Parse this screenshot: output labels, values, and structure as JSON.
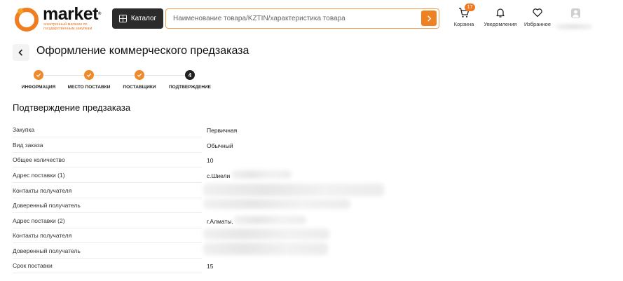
{
  "header": {
    "logo_word": "market",
    "logo_sub": "электронный магазин по государственным закупкам",
    "catalog_label": "Каталог",
    "search_placeholder": "Наименование товара/KZTIN/характеристика товара",
    "cart_label": "Корзина",
    "cart_count": "17",
    "notifications_label": "Уведомления",
    "favorites_label": "Избранное",
    "accent_color": "#ee8223"
  },
  "page": {
    "title": "Оформление коммерческого предзаказа",
    "section_title": "Подтверждение предзаказа"
  },
  "stepper": {
    "steps": [
      {
        "label": "ИНФОРМАЦИЯ",
        "state": "done"
      },
      {
        "label": "МЕСТО ПОСТАВКИ",
        "state": "done"
      },
      {
        "label": "ПОСТАВЩИКИ",
        "state": "done"
      },
      {
        "label": "ПОДТВЕРЖДЕНИЕ",
        "state": "current",
        "number": "4"
      }
    ]
  },
  "details": {
    "rows": [
      {
        "label": "Закупка",
        "value": "Первичная"
      },
      {
        "label": "Вид заказа",
        "value": "Обычный"
      },
      {
        "label": "Общее количество",
        "value": "10"
      },
      {
        "label": "Адрес поставки (1)",
        "value": "с.Шиели"
      },
      {
        "label": "Контакты получателя",
        "value": ""
      },
      {
        "label": "Доверенный получатель",
        "value": ""
      },
      {
        "label": "Адрес поставки (2)",
        "value": "г.Алматы,"
      },
      {
        "label": "Контакты получателя",
        "value": ""
      },
      {
        "label": "Доверенный получатель",
        "value": ""
      },
      {
        "label": "Срок поставки",
        "value": "15"
      }
    ]
  }
}
